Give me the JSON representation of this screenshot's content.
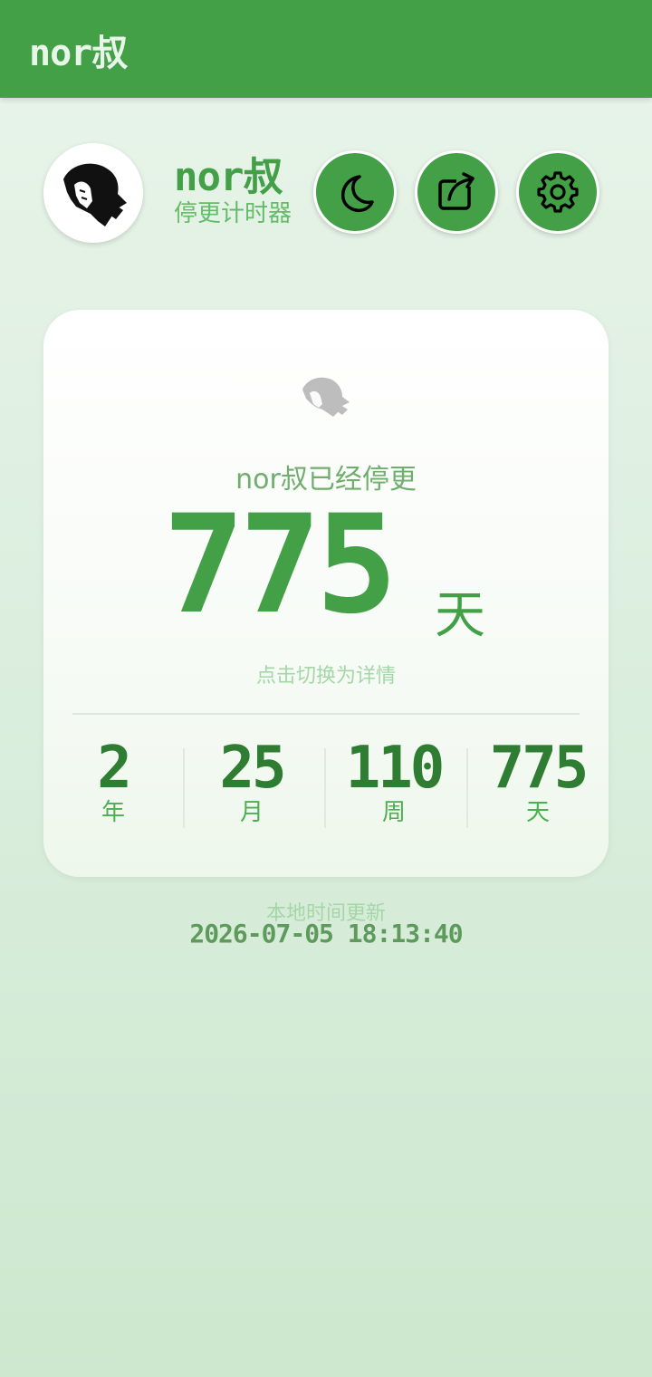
{
  "app_bar": {
    "title": "nor叔"
  },
  "profile": {
    "name": "nor叔",
    "subtitle": "停更计时器"
  },
  "actions": {
    "theme_icon": "moon-icon",
    "share_icon": "share-icon",
    "settings_icon": "gear-icon"
  },
  "counter": {
    "headline": "nor叔已经停更",
    "days": "775",
    "unit": "天",
    "tap_hint": "点击切换为详情"
  },
  "stats": [
    {
      "value": "2",
      "label": "年"
    },
    {
      "value": "25",
      "label": "月"
    },
    {
      "value": "110",
      "label": "周"
    },
    {
      "value": "775",
      "label": "天"
    }
  ],
  "footer": {
    "update_label": "本地时间更新",
    "update_time": "2026-07-05 18:13:40"
  },
  "colors": {
    "primary": "#43a047",
    "dark": "#2e7d32",
    "light": "#a5d6a7"
  }
}
